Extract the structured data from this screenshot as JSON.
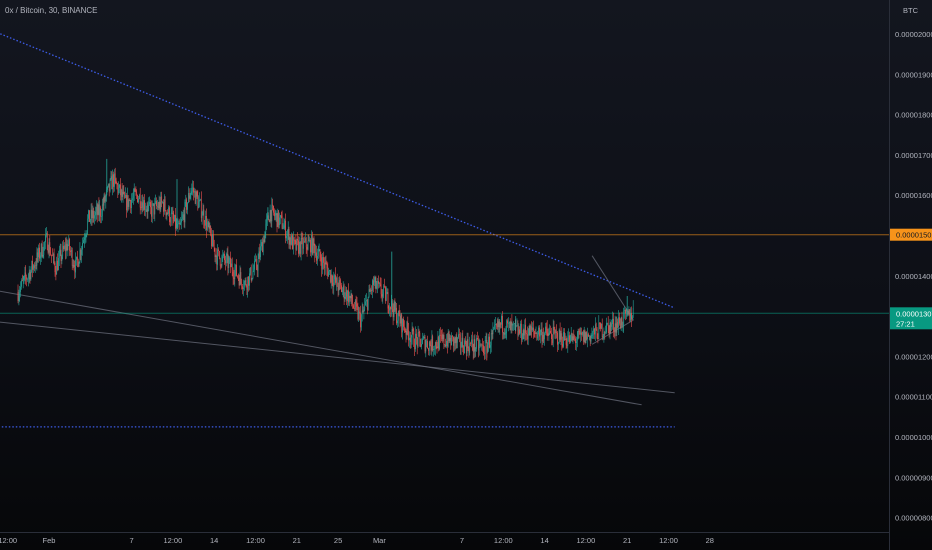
{
  "symbol": {
    "name": "0x / Bitcoin",
    "interval": "30",
    "exchange": "BINANCE"
  },
  "currency_label": "BTC",
  "chart_data": {
    "type": "candlestick",
    "price_axis": {
      "ticks": [
        8e-06,
        9e-06,
        1e-05,
        1.1e-05,
        1.2e-05,
        1.3e-05,
        1.4e-05,
        1.5e-05,
        1.6e-05,
        1.7e-05,
        1.8e-05,
        1.9e-05,
        2e-05
      ],
      "tick_labels": [
        "0.00000800",
        "0.00000900",
        "0.00001000",
        "0.00001100",
        "0.00001200",
        "0.00001300",
        "0.00001400",
        "0.00001500",
        "0.00001600",
        "0.00001700",
        "0.00001800",
        "0.00001900",
        "0.00002000"
      ]
    },
    "time_axis": {
      "labels": [
        {
          "text": "12:00",
          "day": -0.25
        },
        {
          "text": "Feb",
          "day": 0.75
        },
        {
          "text": "7",
          "day": 2.75
        },
        {
          "text": "12:00",
          "day": 3.75
        },
        {
          "text": "14",
          "day": 4.75
        },
        {
          "text": "12:00",
          "day": 5.75
        },
        {
          "text": "21",
          "day": 6.75
        },
        {
          "text": "25",
          "day": 7.75
        },
        {
          "text": "Mar",
          "day": 8.75
        },
        {
          "text": "7",
          "day": 10.75
        },
        {
          "text": "12:00",
          "day": 11.75
        },
        {
          "text": "14",
          "day": 12.75
        },
        {
          "text": "12:00",
          "day": 13.75
        },
        {
          "text": "21",
          "day": 14.75
        },
        {
          "text": "12:00",
          "day": 15.75
        },
        {
          "text": "28",
          "day": 16.75
        }
      ]
    },
    "price_path": [
      [
        0,
        1.36e-05
      ],
      [
        0.4,
        1.43e-05
      ],
      [
        0.7,
        1.49e-05
      ],
      [
        0.9,
        1.42e-05
      ],
      [
        1.2,
        1.48e-05
      ],
      [
        1.4,
        1.42e-05
      ],
      [
        1.7,
        1.54e-05
      ],
      [
        2.0,
        1.56e-05
      ],
      [
        2.3,
        1.64e-05
      ],
      [
        2.6,
        1.58e-05
      ],
      [
        2.9,
        1.6e-05
      ],
      [
        3.2,
        1.56e-05
      ],
      [
        3.5,
        1.58e-05
      ],
      [
        3.9,
        1.51e-05
      ],
      [
        4.2,
        1.62e-05
      ],
      [
        4.5,
        1.55e-05
      ],
      [
        4.8,
        1.45e-05
      ],
      [
        5.1,
        1.43e-05
      ],
      [
        5.5,
        1.38e-05
      ],
      [
        5.8,
        1.43e-05
      ],
      [
        6.1,
        1.56e-05
      ],
      [
        6.4,
        1.53e-05
      ],
      [
        6.7,
        1.47e-05
      ],
      [
        7.1,
        1.48e-05
      ],
      [
        7.4,
        1.43e-05
      ],
      [
        7.7,
        1.38e-05
      ],
      [
        8.0,
        1.35e-05
      ],
      [
        8.3,
        1.29e-05
      ],
      [
        8.6,
        1.38e-05
      ],
      [
        8.9,
        1.35e-05
      ],
      [
        9.3,
        1.28e-05
      ],
      [
        9.6,
        1.24e-05
      ],
      [
        10.0,
        1.23e-05
      ],
      [
        10.4,
        1.24e-05
      ],
      [
        10.8,
        1.23e-05
      ],
      [
        11.3,
        1.22e-05
      ],
      [
        11.7,
        1.28e-05
      ],
      [
        12.1,
        1.26e-05
      ],
      [
        12.6,
        1.26e-05
      ],
      [
        13.0,
        1.25e-05
      ],
      [
        13.4,
        1.24e-05
      ],
      [
        13.8,
        1.25e-05
      ],
      [
        14.2,
        1.27e-05
      ],
      [
        14.5,
        1.28e-05
      ],
      [
        14.9,
        1.31e-05
      ]
    ],
    "wicks": [
      {
        "day": 2.15,
        "high": 1.69e-05
      },
      {
        "day": 3.85,
        "high": 1.64e-05
      },
      {
        "day": 6.05,
        "high": 1.57e-05
      },
      {
        "day": 9.05,
        "high": 1.46e-05
      },
      {
        "day": 12.05,
        "high": 1.3e-05
      },
      {
        "day": 14.75,
        "high": 1.35e-05
      },
      {
        "day": 11.35,
        "low": 1.19e-05
      }
    ],
    "horizontal_lines": [
      {
        "price": 1.502e-05,
        "label": "0.00001502",
        "color": "#f7931a"
      },
      {
        "price": 1.307e-05,
        "label": "0.00001307",
        "color": "#089981"
      }
    ],
    "current_price": {
      "value": "0.00001307",
      "countdown": "27:21"
    },
    "trend_lines": [
      {
        "style": "dotted",
        "color": "#3d5ce8",
        "from": {
          "day": -0.9,
          "price": 2.02e-05
        },
        "to": {
          "day": 15.9,
          "price": 1.32e-05
        }
      },
      {
        "style": "dotted",
        "color": "#3d5ce8",
        "from": {
          "day": -0.9,
          "price": 1.025e-05
        },
        "to": {
          "day": 15.9,
          "price": 1.025e-05
        }
      },
      {
        "style": "solid",
        "color": "#6b6f7c",
        "from": {
          "day": -0.9,
          "price": 1.37e-05
        },
        "to": {
          "day": 15.1,
          "price": 1.08e-05
        }
      },
      {
        "style": "solid",
        "color": "#6b6f7c",
        "from": {
          "day": -0.9,
          "price": 1.29e-05
        },
        "to": {
          "day": 15.9,
          "price": 1.11e-05
        }
      },
      {
        "style": "solid",
        "color": "#6b6f7c",
        "from": {
          "day": 13.9,
          "price": 1.23e-05
        },
        "to": {
          "day": 14.9,
          "price": 1.29e-05
        }
      },
      {
        "style": "solid",
        "color": "#6b6f7c",
        "from": {
          "day": 14.9,
          "price": 1.29e-05
        },
        "to": {
          "day": 13.9,
          "price": 1.45e-05
        }
      }
    ]
  }
}
